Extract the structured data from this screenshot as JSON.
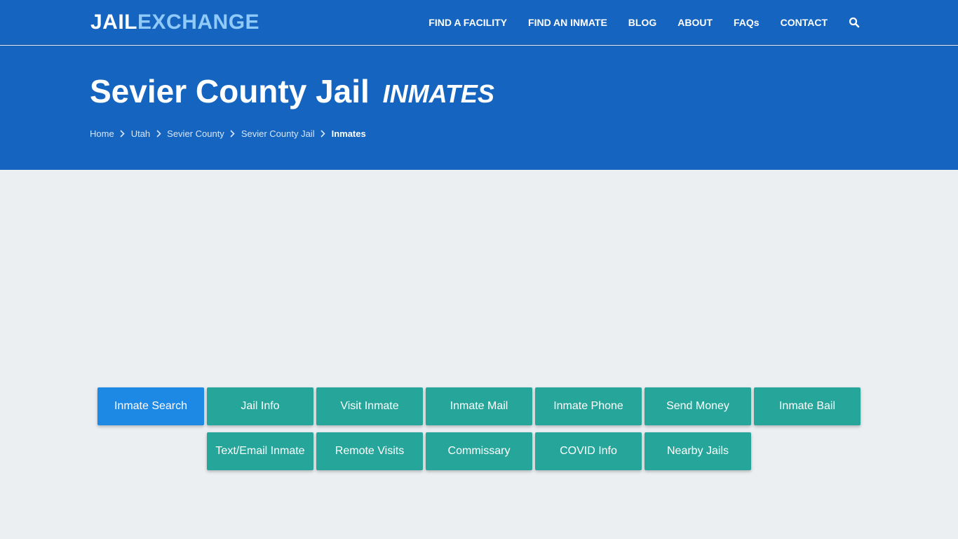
{
  "brand": {
    "part1": "JAIL",
    "part2": "EXCHANGE"
  },
  "nav": {
    "items": [
      "FIND A FACILITY",
      "FIND AN INMATE",
      "BLOG",
      "ABOUT",
      "FAQs",
      "CONTACT"
    ],
    "search_icon": "search-icon"
  },
  "hero": {
    "title": "Sevier County Jail",
    "subtitle": "INMATES"
  },
  "breadcrumb": [
    "Home",
    "Utah",
    "Sevier County",
    "Sevier County Jail",
    "Inmates"
  ],
  "buttons": {
    "row1": [
      "Inmate Search",
      "Jail Info",
      "Visit Inmate",
      "Inmate Mail",
      "Inmate Phone",
      "Send Money",
      "Inmate Bail"
    ],
    "row2": [
      "Text/Email Inmate",
      "Remote Visits",
      "Commissary",
      "COVID Info",
      "Nearby Jails"
    ]
  },
  "colors": {
    "header": "#1565c0",
    "logo_accent": "#90caf9",
    "active_button": "#1e88e5",
    "button": "#26a69a",
    "background": "#ebeff2"
  }
}
